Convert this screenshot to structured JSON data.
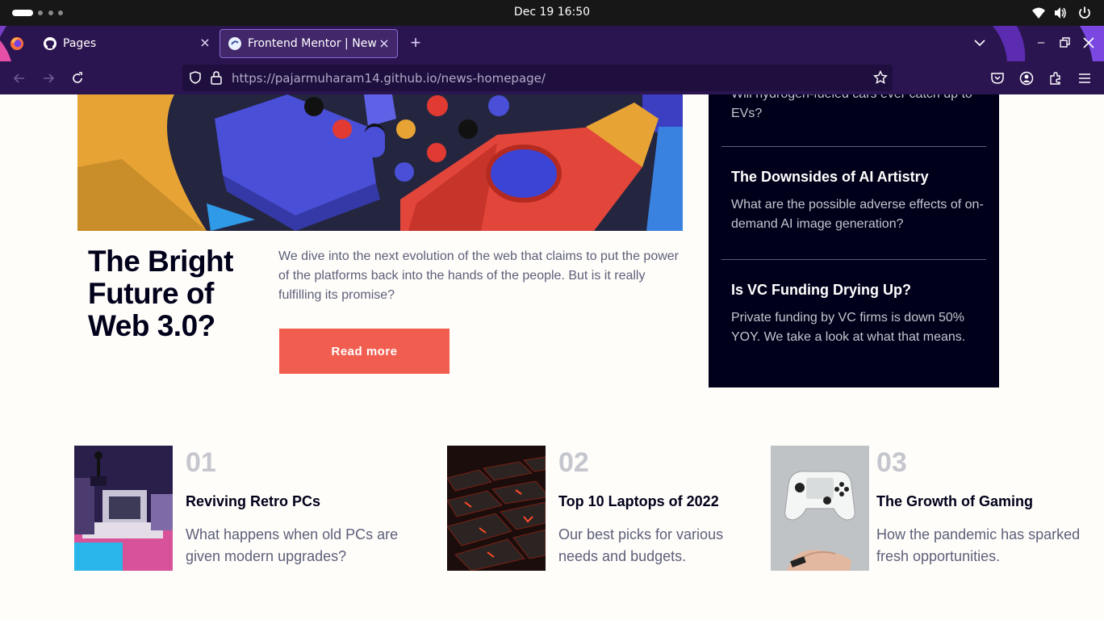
{
  "system": {
    "clock": "Dec 19  16:50",
    "icons": [
      "activities-pill",
      "workspace-dots",
      "wifi-icon",
      "volume-icon",
      "power-icon"
    ]
  },
  "browser": {
    "tabs": [
      {
        "label": "Pages",
        "icon": "github-icon",
        "active": false
      },
      {
        "label": "Frontend Mentor | News homepage",
        "icon": "frontend-mentor-icon",
        "active": true
      }
    ],
    "url_host": "https://pajarmuharam14.github.io",
    "url_path": "/news-homepage/",
    "colors": {
      "chrome": "#2b1550",
      "urlbar": "#1e0f3e",
      "active_tab_border": "#8a6cd4"
    }
  },
  "hero": {
    "title": "The Bright Future of Web 3.0?",
    "description": "We dive into the next evolution of the web that claims to put the power of the platforms back into the hands of the people. But is it really fulfilling its promise?",
    "button": "Read more"
  },
  "new_panel": {
    "partial_text": "Will hydrogen-fueled cars ever catch up to EVs?",
    "items": [
      {
        "title": "The Downsides of AI Artistry",
        "description": "What are the possible adverse effects of on-demand AI image generation?"
      },
      {
        "title": "Is VC Funding Drying Up?",
        "description": "Private funding by VC firms is down 50% YOY. We take a look at what that means."
      }
    ]
  },
  "cards": [
    {
      "number": "01",
      "title": "Reviving Retro PCs",
      "description": "What happens when old PCs are given modern upgrades?"
    },
    {
      "number": "02",
      "title": "Top 10 Laptops of 2022",
      "description": "Our best picks for various needs and budgets."
    },
    {
      "number": "03",
      "title": "The Growth of Gaming",
      "description": "How the pandemic has sparked fresh opportunities."
    }
  ],
  "colors": {
    "accent": "#f15e50",
    "dark": "#00001a",
    "muted": "#5d5f79",
    "number": "#c5c6ce"
  }
}
